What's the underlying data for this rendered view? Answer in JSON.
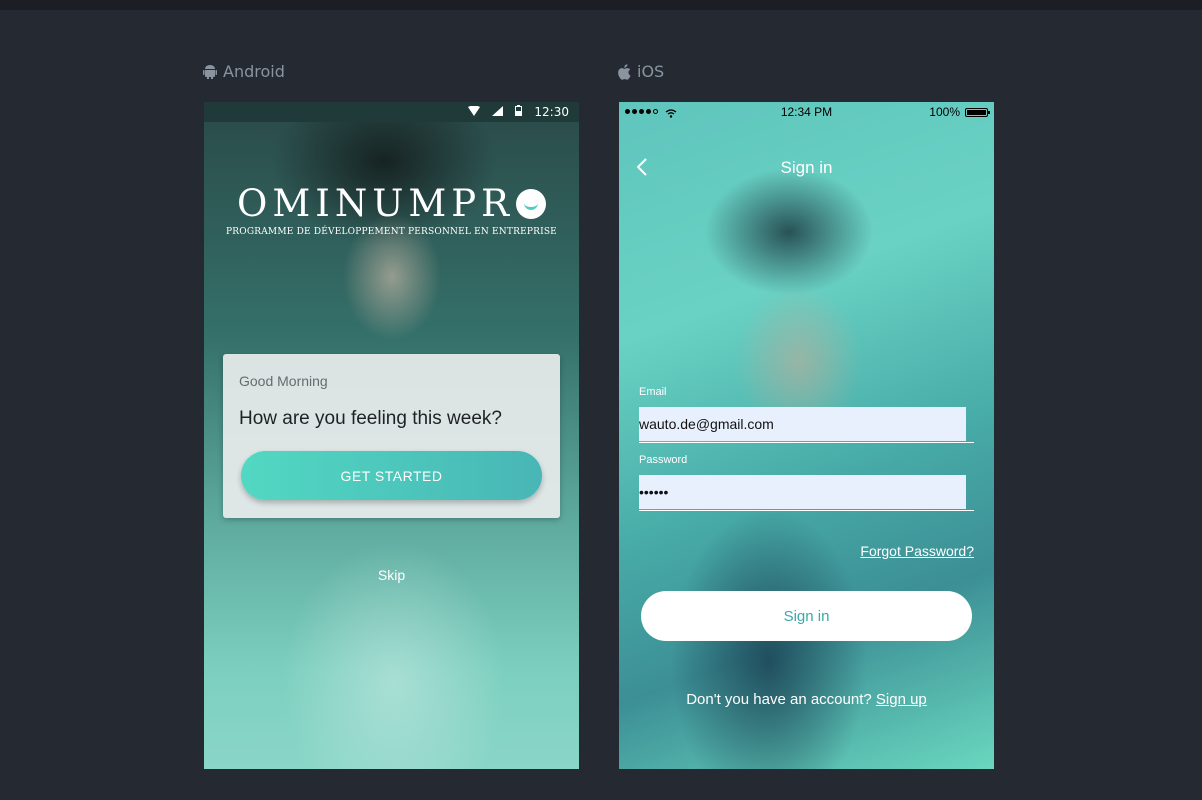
{
  "platforms": {
    "android_label": "Android",
    "ios_label": "iOS"
  },
  "android": {
    "status_time": "12:30",
    "logo_text": "OMINUMPR",
    "logo_subtitle": "PROGRAMME DE DÉVELOPPEMENT PERSONNEL EN ENTREPRISE",
    "card": {
      "greeting": "Good Morning",
      "question": "How are you feeling this week?",
      "cta_label": "GET STARTED"
    },
    "skip_label": "Skip"
  },
  "ios": {
    "status_time": "12:34 PM",
    "battery_pct": "100%",
    "title": "Sign in",
    "email_label": "Email",
    "email_value": "wauto.de@gmail.com",
    "password_label": "Password",
    "password_value": "••••••",
    "forgot_label": "Forgot Password?",
    "signin_label": "Sign in",
    "signup_prompt": "Don't you have an account?",
    "signup_link": "Sign up"
  },
  "colors": {
    "page_bg": "#252a32",
    "accent_teal": "#4ecdc0",
    "signin_text": "#3aa7ac"
  }
}
